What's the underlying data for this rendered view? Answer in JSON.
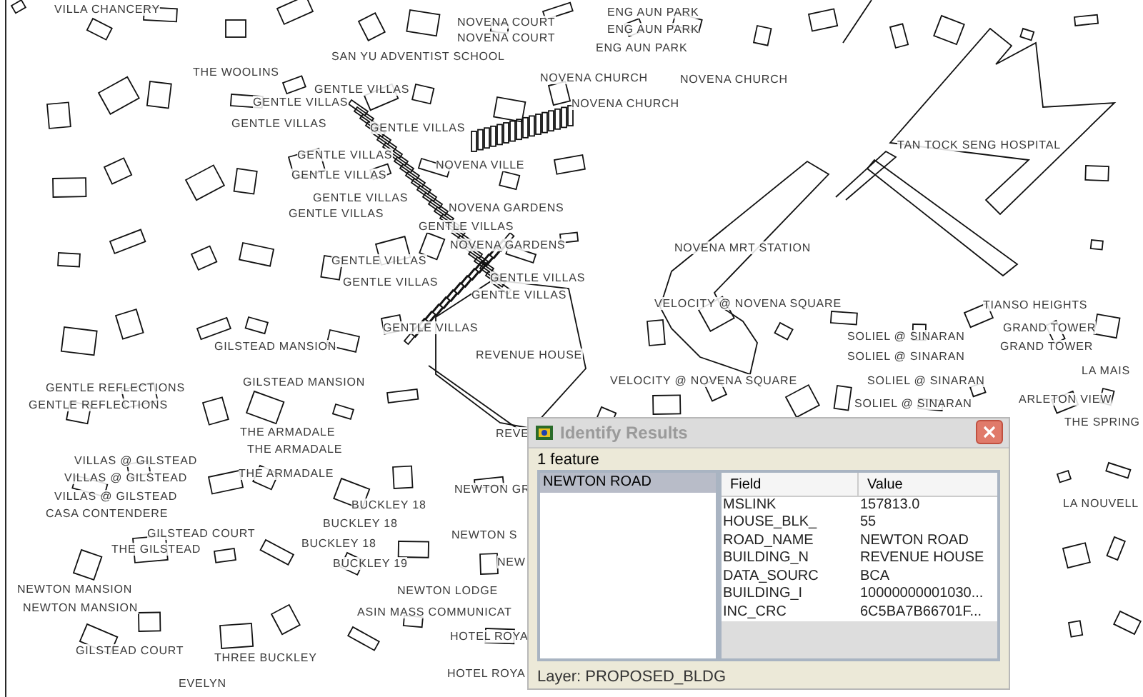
{
  "map": {
    "labels": [
      "VILLA CHANCERY",
      "ENG AUN PARK",
      "NOVENA COURT",
      "ENG AUN PARK",
      "NOVENA COURT",
      "ENG AUN PARK",
      "SAN YU ADVENTIST SCHOOL",
      "THE WOOLINS",
      "NOVENA CHURCH",
      "NOVENA CHURCH",
      "GENTLE VILLAS",
      "GENTLE VILLAS",
      "NOVENA CHURCH",
      "GENTLE VILLAS",
      "GENTLE VILLAS",
      "TAN TOCK SENG HOSPITAL",
      "GENTLE VILLAS",
      "NOVENA VILLE",
      "GENTLE VILLAS",
      "GENTLE VILLAS",
      "GENTLE VILLAS",
      "NOVENA GARDENS",
      "GENTLE VILLAS",
      "NOVENA GARDENS",
      "NOVENA MRT STATION",
      "GENTLE VILLAS",
      "GENTLE VILLAS",
      "GENTLE VILLAS",
      "GENTLE VILLAS",
      "VELOCITY @ NOVENA SQUARE",
      "TIANSO HEIGHTS",
      "GENTLE VILLAS",
      "GRAND TOWER",
      "SOLIEL @ SINARAN",
      "GILSTEAD MANSION",
      "GRAND TOWER",
      "REVENUE HOUSE",
      "SOLIEL @ SINARAN",
      "LA MAIS",
      "GENTLE REFLECTIONS",
      "GILSTEAD MANSION",
      "VELOCITY @ NOVENA SQUARE",
      "SOLIEL @ SINARAN",
      "GENTLE REFLECTIONS",
      "SOLIEL @ SINARAN",
      "ARLETON VIEW",
      "THE SPRING",
      "THE ARMADALE",
      "REVE",
      "THE ARMADALE",
      "VILLAS @ GILSTEAD",
      "VILLAS @ GILSTEAD",
      "THE ARMADALE",
      "VILLAS @ GILSTEAD",
      "NEWTON GR",
      "BUCKLEY 18",
      "LA NOUVELL",
      "CASA CONTENDERE",
      "BUCKLEY 18",
      "GILSTEAD COURT",
      "NEWTON S",
      "THE GILSTEAD",
      "BUCKLEY 18",
      "BUCKLEY 19",
      "NEW",
      "NEWTON MANSION",
      "NEWTON LODGE",
      "NEWTON MANSION",
      "ASIN MASS COMMUNICAT",
      "HOTEL ROYA",
      "GILSTEAD COURT",
      "THREE BUCKLEY",
      "HOTEL ROYA",
      "EVELYN"
    ]
  },
  "dialog": {
    "title": "Identify Results",
    "count": "1 feature",
    "features": [
      {
        "label": "NEWTON ROAD",
        "selected": true
      }
    ],
    "columns": [
      "Field",
      "Value"
    ],
    "rows": [
      [
        "MSLINK",
        "157813.0"
      ],
      [
        "HOUSE_BLK_",
        "55"
      ],
      [
        "ROAD_NAME",
        "NEWTON ROAD"
      ],
      [
        "BUILDING_N",
        "REVENUE HOUSE"
      ],
      [
        "DATA_SOURC",
        "BCA"
      ],
      [
        "BUILDING_I",
        "10000000001030..."
      ],
      [
        "INC_CRC",
        "6C5BA7B66701F..."
      ]
    ],
    "layer": "Layer: PROPOSED_BLDG"
  }
}
